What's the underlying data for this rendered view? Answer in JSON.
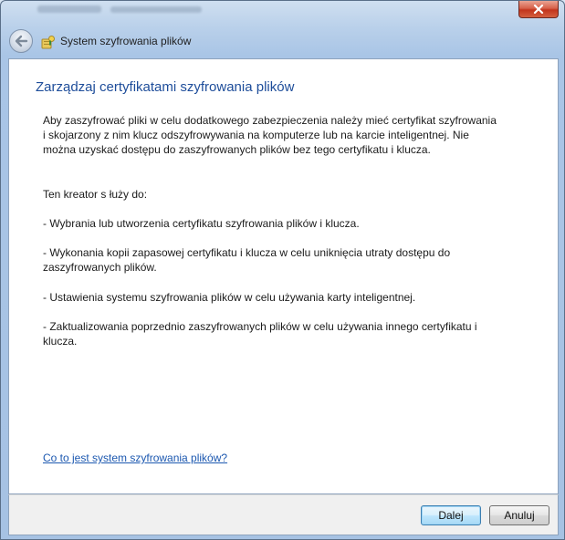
{
  "window": {
    "close_icon": "close-icon",
    "back_icon": "back-arrow-icon",
    "wizard_icon": "encryption-key-icon"
  },
  "nav": {
    "title": "System szyfrowania plików"
  },
  "content": {
    "heading": "Zarządzaj certyfikatami szyfrowania plików",
    "intro": "Aby zaszyfrować pliki w celu dodatkowego zabezpieczenia należy mieć certyfikat szyfrowania i skojarzony z nim klucz odszyfrowywania na komputerze lub na karcie inteligentnej. Nie można uzyskać dostępu do zaszyfrowanych plików bez tego certyfikatu i klucza.",
    "purpose": "Ten kreator s łuży do:",
    "bullets": [
      "- Wybrania lub utworzenia certyfikatu szyfrowania plików i klucza.",
      "- Wykonania kopii zapasowej certyfikatu i klucza w celu uniknięcia utraty dostępu do zaszyfrowanych plików.",
      "- Ustawienia systemu szyfrowania plików w celu używania karty inteligentnej.",
      "- Zaktualizowania poprzednio zaszyfrowanych plików w celu używania innego certyfikatu i klucza."
    ],
    "help_link": "Co to jest system szyfrowania plików?"
  },
  "buttons": {
    "next": "Dalej",
    "cancel": "Anuluj"
  }
}
